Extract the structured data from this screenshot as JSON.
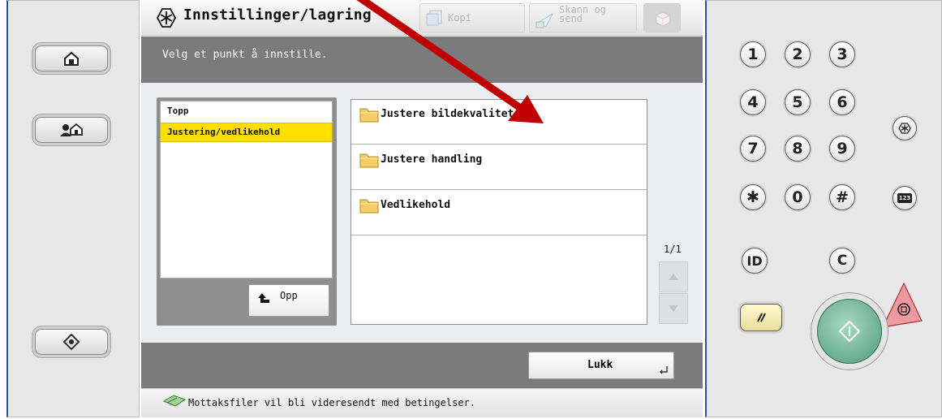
{
  "title": {
    "text": "Innstillinger/lagring",
    "icon": "settings-icon"
  },
  "tabs": [
    {
      "label": "Kopi",
      "icon": "copy-icon"
    },
    {
      "label": "Skann og send",
      "icon": "scan-send-icon"
    },
    {
      "label": "",
      "icon": "cube-icon"
    }
  ],
  "instruction": "Velg et punkt å innstille.",
  "tree": {
    "items": [
      {
        "label": "Topp",
        "selected": false
      },
      {
        "label": "Justering/vedlikehold",
        "selected": true
      }
    ],
    "up_label": "Opp"
  },
  "folders": [
    {
      "label": "Justere bildekvalitet",
      "icon": "folder-icon"
    },
    {
      "label": "Justere handling",
      "icon": "folder-icon"
    },
    {
      "label": "Vedlikehold",
      "icon": "folder-icon"
    }
  ],
  "pager": {
    "text": "1/1"
  },
  "close_label": "Lukk",
  "status": {
    "text": "Mottaksfiler vil bli videresendt med betingelser.",
    "icon": "forward-icon"
  },
  "keypad": {
    "keys": [
      "1",
      "2",
      "3",
      "4",
      "5",
      "6",
      "7",
      "8",
      "9",
      "✱",
      "0",
      "#"
    ],
    "id_label": "ID",
    "clear_label": "C",
    "counter_label": "123"
  },
  "colors": {
    "selection": "#ffde00",
    "annotation_arrow": "#c00000",
    "start_button": "#5aa88a",
    "stop_button": "#e8858a"
  }
}
